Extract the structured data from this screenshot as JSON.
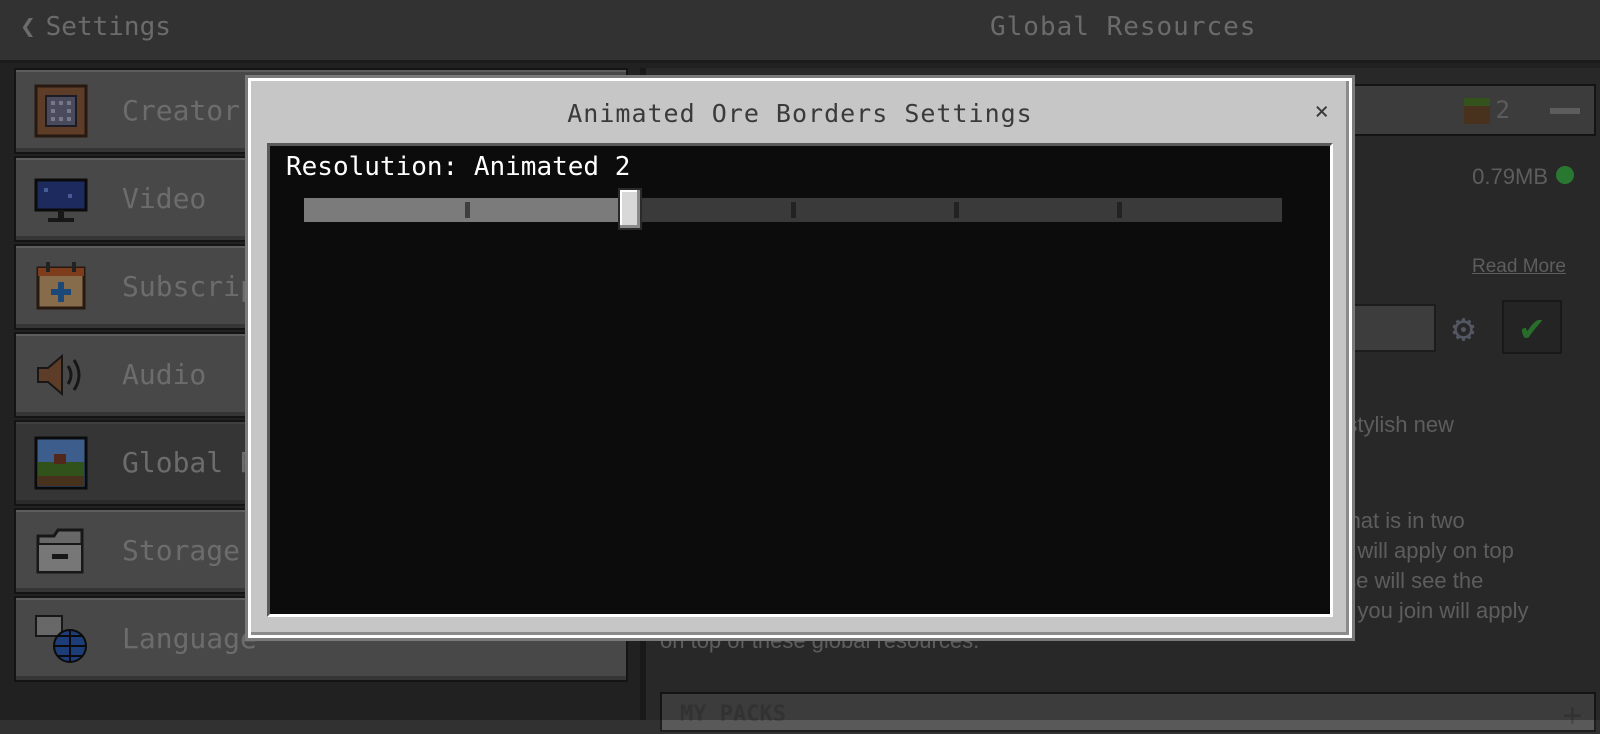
{
  "header": {
    "back_label": "Settings",
    "title": "Global Resources"
  },
  "sidebar": {
    "items": [
      {
        "label": "Creator",
        "icon": "creator-icon"
      },
      {
        "label": "Video",
        "icon": "monitor-icon"
      },
      {
        "label": "Subscriptions",
        "icon": "calendar-plus-icon"
      },
      {
        "label": "Audio",
        "icon": "speaker-icon"
      },
      {
        "label": "Global Resources",
        "icon": "landscape-icon",
        "active": true
      },
      {
        "label": "Storage",
        "icon": "folder-icon"
      },
      {
        "label": "Language",
        "icon": "globe-icon"
      }
    ]
  },
  "right_pane": {
    "active_count": "2",
    "pack_size": "0.79MB",
    "read_more": "Read More",
    "desc_lines": [
      "h stylish new",
      "et that is in two",
      "ds will apply on top",
      " else will see the",
      "ds you join will apply",
      "on top of these global resources."
    ],
    "my_packs_label": "MY PACKS"
  },
  "modal": {
    "title": "Animated Ore Borders Settings",
    "close_glyph": "×",
    "resolution_label": "Resolution: Animated 2",
    "slider": {
      "steps": 7,
      "selected_index": 2
    }
  },
  "colors": {
    "accent_green": "#3ca140",
    "status_dot": "#3bb24a"
  }
}
